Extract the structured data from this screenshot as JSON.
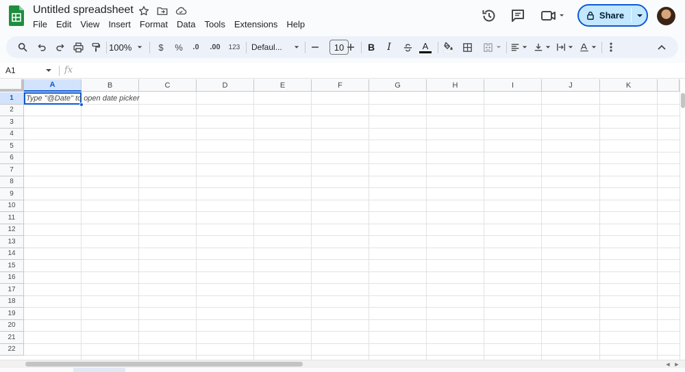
{
  "document": {
    "title": "Untitled spreadsheet"
  },
  "menu": [
    "File",
    "Edit",
    "View",
    "Insert",
    "Format",
    "Data",
    "Tools",
    "Extensions",
    "Help"
  ],
  "share": {
    "label": "Share"
  },
  "toolbar": {
    "zoom": "100%",
    "currency": "$",
    "percent": "%",
    "decrease_decimal": ".0",
    "increase_decimal": ".00",
    "number_format": "123",
    "font": "Defaul...",
    "font_size": "10",
    "bold": "B",
    "italic": "I",
    "text_color": "A"
  },
  "formula_bar": {
    "name_box": "A1",
    "fx": "fx"
  },
  "grid": {
    "columns": [
      "A",
      "B",
      "C",
      "D",
      "E",
      "F",
      "G",
      "H",
      "I",
      "J",
      "K"
    ],
    "rows": [
      "1",
      "2",
      "3",
      "4",
      "5",
      "6",
      "7",
      "8",
      "9",
      "10",
      "11",
      "12",
      "13",
      "14",
      "15",
      "16",
      "17",
      "18",
      "19",
      "20",
      "21",
      "22"
    ],
    "selected_column": "A",
    "selected_row": "1",
    "cell_hint": "Type \"@Date\" to open date picker"
  },
  "icons": {
    "logo": "sheets-logo-icon",
    "star": "star-icon",
    "move": "move-folder-icon",
    "cloud": "cloud-saved-icon",
    "history": "history-icon",
    "comment": "comment-icon",
    "meet": "video-call-icon",
    "lock": "lock-icon"
  },
  "colors": {
    "accent": "#0b57d0",
    "share_bg": "#c2e7ff",
    "sheets_green": "#1e8e3e"
  }
}
